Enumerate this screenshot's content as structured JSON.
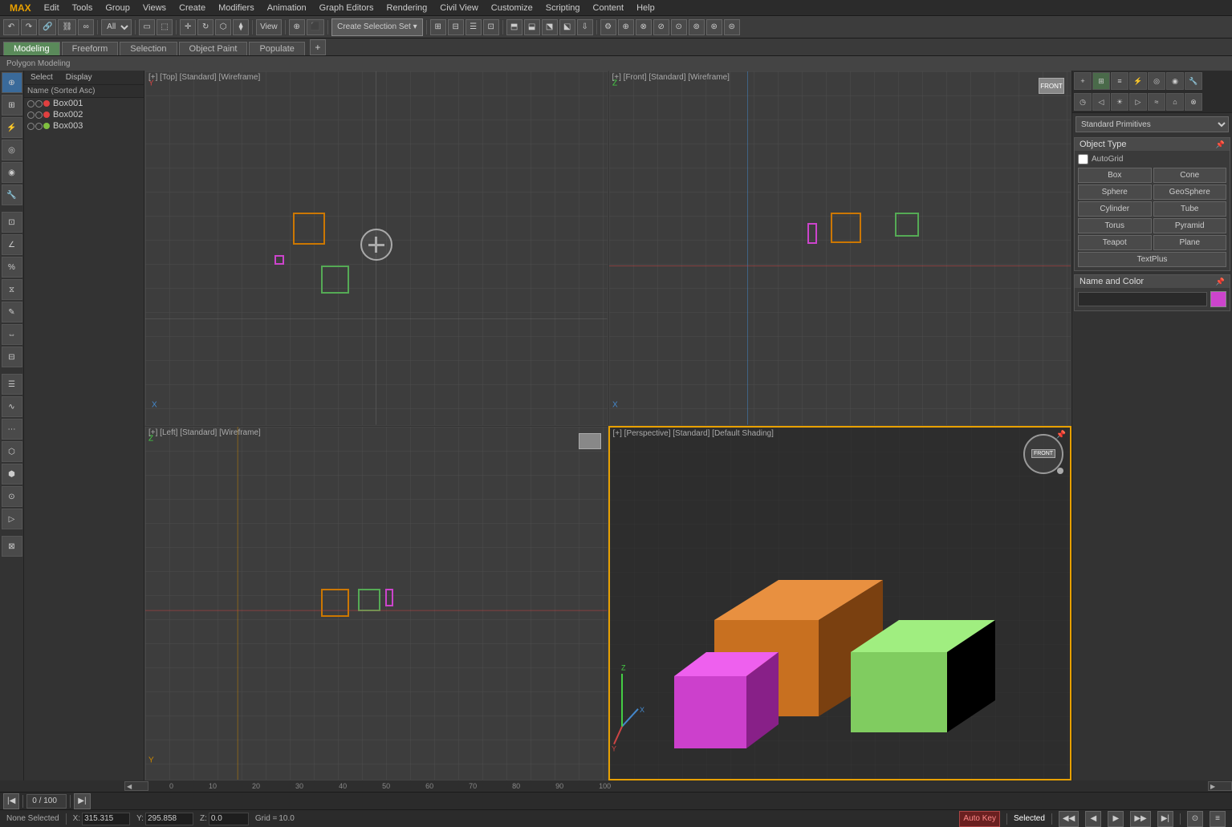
{
  "menu": {
    "brand": "MAX",
    "items": [
      "Edit",
      "Tools",
      "Group",
      "Views",
      "Create",
      "Modifiers",
      "Animation",
      "Graph Editors",
      "Rendering",
      "Civil View",
      "Customize",
      "Scripting",
      "Content",
      "Help"
    ]
  },
  "toolbar": {
    "mode_dropdown": "All",
    "create_selection_btn": "Create Selection Set",
    "view_btn": "View"
  },
  "tabs": {
    "items": [
      "Modeling",
      "Freeform",
      "Selection",
      "Object Paint",
      "Populate"
    ],
    "active": "Modeling",
    "sub_label": "Polygon Modeling"
  },
  "sub_tabs": {
    "items": [
      "Select",
      "Display"
    ]
  },
  "scene_tree": {
    "header": "Name (Sorted Asc)",
    "items": [
      {
        "name": "Box001",
        "color": "#e04040"
      },
      {
        "name": "Box002",
        "color": "#e04040"
      },
      {
        "name": "Box003",
        "color": "#80c040"
      }
    ]
  },
  "viewports": {
    "top": {
      "label": "[+] [Top] [Standard] [Wireframe]",
      "active": false
    },
    "front": {
      "label": "[+] [Front] [Standard] [Wireframe]",
      "active": false
    },
    "left": {
      "label": "[+] [Left] [Standard] [Wireframe]",
      "active": false
    },
    "perspective": {
      "label": "[+] [Perspective] [Standard] [Default Shading]",
      "active": true
    }
  },
  "right_panel": {
    "dropdown_label": "Standard Primitives",
    "object_type_header": "Object Type",
    "autogrid_label": "AutoGrid",
    "buttons": [
      "Box",
      "Cone",
      "Sphere",
      "GeoSphere",
      "Cylinder",
      "Tube",
      "Torus",
      "Pyramid",
      "Teapot",
      "Plane",
      "TextPlus"
    ],
    "name_color_header": "Name and Color",
    "color": "#cc44cc"
  },
  "timeline": {
    "current": "0",
    "total": "100",
    "label": "0 / 100"
  },
  "coords": {
    "x_label": "X:",
    "x_val": "315.315",
    "y_label": "Y:",
    "y_val": "295.858",
    "z_label": "Z:",
    "z_val": "0.0",
    "grid_label": "Grid =",
    "grid_val": "10.0"
  },
  "status": {
    "none_selected": "None Selected",
    "selected": "Selected",
    "auto_key": "Auto Key"
  }
}
